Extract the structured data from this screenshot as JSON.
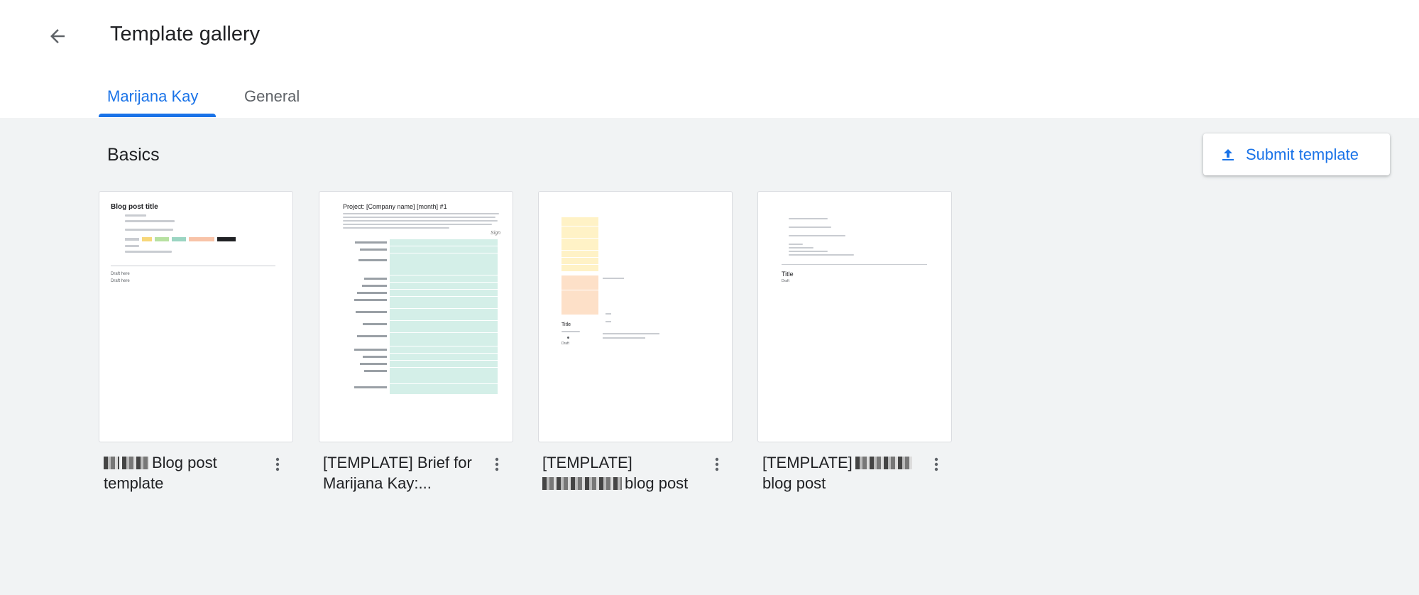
{
  "header": {
    "title": "Template gallery",
    "back_icon": "arrow-back-icon"
  },
  "tabs": [
    {
      "label": "Marijana Kay",
      "active": true
    },
    {
      "label": "General",
      "active": false
    }
  ],
  "section": {
    "title": "Basics"
  },
  "submit": {
    "label": "Submit template",
    "icon": "upload-icon"
  },
  "templates": [
    {
      "name_visible": "Blog post template",
      "thumb_title": "Blog post title",
      "thumb_draft_1": "Draft here",
      "thumb_draft_2": "Draft here"
    },
    {
      "name_visible": "[TEMPLATE] Brief for Marijana Kay:...",
      "thumb_title": "Project: [Company name] [month] #1",
      "thumb_signature": "Sign"
    },
    {
      "name_line1": "[TEMPLATE]",
      "name_line2": "blog post",
      "thumb_title": "Title",
      "thumb_draft": "Draft"
    },
    {
      "name_line1": "[TEMPLATE]",
      "name_line2": "blog post",
      "thumb_title": "Title",
      "thumb_draft": "Draft"
    }
  ],
  "colors": {
    "accent": "#1a73e8",
    "background": "#f1f3f4",
    "teal_cells": "#d4efe8",
    "yellow_cells": "#fff2c6",
    "orange_cells": "#fde0c8"
  }
}
